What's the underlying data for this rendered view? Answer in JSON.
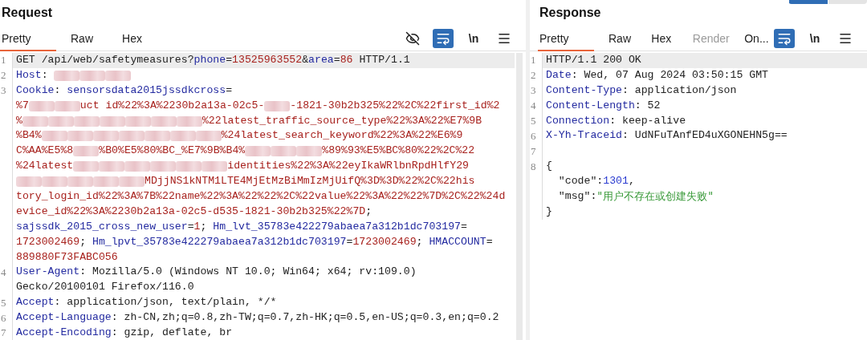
{
  "request": {
    "title": "Request",
    "tabs": [
      {
        "label": "Pretty",
        "selected": true,
        "disabled": false
      },
      {
        "label": "Raw",
        "selected": false,
        "disabled": false
      },
      {
        "label": "Hex",
        "selected": false,
        "disabled": false
      }
    ],
    "toolbar": [
      {
        "kind": "hide"
      },
      {
        "kind": "wrap",
        "on": true
      },
      {
        "kind": "text",
        "label": "\\n"
      },
      {
        "kind": "menu"
      }
    ],
    "lines": [
      {
        "num": "1",
        "highlight": true,
        "segments": [
          {
            "kind": "text",
            "text": "GET /api/web/safetymeasures?"
          },
          {
            "kind": "key",
            "text": "phone"
          },
          {
            "kind": "text",
            "text": "="
          },
          {
            "kind": "val",
            "text": "13525963552"
          },
          {
            "kind": "text",
            "text": "&"
          },
          {
            "kind": "key",
            "text": "area"
          },
          {
            "kind": "text",
            "text": "="
          },
          {
            "kind": "val",
            "text": "86"
          },
          {
            "kind": "text",
            "text": " HTTP/1.1"
          }
        ]
      },
      {
        "num": "2",
        "highlight": false,
        "segments": [
          {
            "kind": "key",
            "text": "Host"
          },
          {
            "kind": "text",
            "text": ": "
          },
          {
            "kind": "redacted"
          },
          {
            "kind": "redacted"
          },
          {
            "kind": "redacted"
          }
        ]
      },
      {
        "num": "3",
        "highlight": false,
        "segments": [
          {
            "kind": "key",
            "text": "Cookie"
          },
          {
            "kind": "text",
            "text": ": "
          },
          {
            "kind": "key",
            "text": "sensorsdata2015jssdkcross"
          },
          {
            "kind": "text",
            "text": "="
          }
        ]
      },
      {
        "highlight": false,
        "segments": [
          {
            "kind": "val",
            "text": "%7"
          },
          {
            "kind": "redacted"
          },
          {
            "kind": "redacted"
          },
          {
            "kind": "val",
            "text": "uct id%22%3A%2230b2a13a-02c5-"
          },
          {
            "kind": "redacted"
          },
          {
            "kind": "val",
            "text": "-1821-30b2b325%22%2C%22first_id%2"
          }
        ]
      },
      {
        "highlight": false,
        "segments": [
          {
            "kind": "val",
            "text": "%"
          },
          {
            "kind": "redacted"
          },
          {
            "kind": "redacted"
          },
          {
            "kind": "redacted"
          },
          {
            "kind": "redacted"
          },
          {
            "kind": "redacted"
          },
          {
            "kind": "redacted"
          },
          {
            "kind": "redacted"
          },
          {
            "kind": "val",
            "text": "%22latest_traffic_source_type%22%3A%22%E7%9B"
          }
        ]
      },
      {
        "highlight": false,
        "segments": [
          {
            "kind": "val",
            "text": "%B4%"
          },
          {
            "kind": "redacted"
          },
          {
            "kind": "redacted"
          },
          {
            "kind": "redacted"
          },
          {
            "kind": "redacted"
          },
          {
            "kind": "redacted"
          },
          {
            "kind": "redacted"
          },
          {
            "kind": "redacted"
          },
          {
            "kind": "val",
            "text": "%24latest_search_keyword%22%3A%22%E6%9"
          }
        ]
      },
      {
        "highlight": false,
        "segments": [
          {
            "kind": "val",
            "text": "C%AA%E5%8"
          },
          {
            "kind": "redacted"
          },
          {
            "kind": "val",
            "text": "%B0%E5%80%BC_%E7%9B%B4%"
          },
          {
            "kind": "redacted"
          },
          {
            "kind": "redacted"
          },
          {
            "kind": "redacted"
          },
          {
            "kind": "val",
            "text": "%89%93%E5%BC%80%22%2C%22"
          }
        ]
      },
      {
        "highlight": false,
        "segments": [
          {
            "kind": "val",
            "text": "%24latest"
          },
          {
            "kind": "redacted"
          },
          {
            "kind": "redacted"
          },
          {
            "kind": "redacted"
          },
          {
            "kind": "redacted"
          },
          {
            "kind": "redacted"
          },
          {
            "kind": "redacted"
          },
          {
            "kind": "val",
            "text": "identities%22%3A%22eyIkaWRlbnRpdHlfY29"
          }
        ]
      },
      {
        "highlight": false,
        "segments": [
          {
            "kind": "redacted"
          },
          {
            "kind": "redacted"
          },
          {
            "kind": "redacted"
          },
          {
            "kind": "redacted"
          },
          {
            "kind": "redacted"
          },
          {
            "kind": "val",
            "text": "MDjjNS1kNTM1LTE4MjEtMzBiMmIzMjUifQ%3D%3D%22%2C%22his"
          }
        ]
      },
      {
        "highlight": false,
        "segments": [
          {
            "kind": "val",
            "text": "tory_login_id%22%3A%7B%22name%22%3A%22%22%2C%22value%22%3A%22%22%7D%2C%22%24d"
          }
        ]
      },
      {
        "highlight": false,
        "segments": [
          {
            "kind": "val",
            "text": "evice_id%22%3A%2230b2a13a-02c5-d535-1821-30b2b325%22%7D"
          },
          {
            "kind": "text",
            "text": ";"
          }
        ]
      },
      {
        "highlight": false,
        "segments": [
          {
            "kind": "key",
            "text": "sajssdk_2015_cross_new_user"
          },
          {
            "kind": "text",
            "text": "="
          },
          {
            "kind": "val",
            "text": "1"
          },
          {
            "kind": "text",
            "text": "; "
          },
          {
            "kind": "key",
            "text": "Hm_lvt_35783e422279abaea7a312b1dc703197"
          },
          {
            "kind": "text",
            "text": "="
          }
        ]
      },
      {
        "highlight": false,
        "segments": [
          {
            "kind": "val",
            "text": "1723002469"
          },
          {
            "kind": "text",
            "text": "; "
          },
          {
            "kind": "key",
            "text": "Hm_lpvt_35783e422279abaea7a312b1dc703197"
          },
          {
            "kind": "text",
            "text": "="
          },
          {
            "kind": "val",
            "text": "1723002469"
          },
          {
            "kind": "text",
            "text": "; "
          },
          {
            "kind": "key",
            "text": "HMACCOUNT"
          },
          {
            "kind": "text",
            "text": "="
          }
        ]
      },
      {
        "highlight": false,
        "segments": [
          {
            "kind": "val",
            "text": "889880F73FABC056"
          }
        ]
      },
      {
        "num": "4",
        "highlight": false,
        "segments": [
          {
            "kind": "key",
            "text": "User-Agent"
          },
          {
            "kind": "text",
            "text": ": Mozilla/5.0 (Windows NT 10.0; Win64; x64; rv:109.0)"
          }
        ]
      },
      {
        "highlight": false,
        "segments": [
          {
            "kind": "text",
            "text": "Gecko/20100101 Firefox/116.0"
          }
        ]
      },
      {
        "num": "5",
        "highlight": false,
        "segments": [
          {
            "kind": "key",
            "text": "Accept"
          },
          {
            "kind": "text",
            "text": ": application/json, text/plain, */*"
          }
        ]
      },
      {
        "num": "6",
        "highlight": false,
        "segments": [
          {
            "kind": "key",
            "text": "Accept-Language"
          },
          {
            "kind": "text",
            "text": ": zh-CN,zh;q=0.8,zh-TW;q=0.7,zh-HK;q=0.5,en-US;q=0.3,en;q=0.2"
          }
        ]
      },
      {
        "num": "7",
        "highlight": false,
        "segments": [
          {
            "kind": "key",
            "text": "Accept-Encoding"
          },
          {
            "kind": "text",
            "text": ": gzip, deflate, br"
          }
        ]
      }
    ]
  },
  "response": {
    "title": "Response",
    "view_toggle": [
      {
        "selected": true
      },
      {
        "selected": false
      }
    ],
    "tabs": [
      {
        "label": "Pretty",
        "selected": true,
        "disabled": false
      },
      {
        "label": "Raw",
        "selected": false,
        "disabled": false
      },
      {
        "label": "Hex",
        "selected": false,
        "disabled": false
      },
      {
        "label": "Render",
        "selected": false,
        "disabled": true
      },
      {
        "label": "On...",
        "selected": false,
        "disabled": false
      }
    ],
    "toolbar": [
      {
        "kind": "wrap",
        "on": true
      },
      {
        "kind": "text",
        "label": "\\n"
      },
      {
        "kind": "menu"
      }
    ],
    "lines": [
      {
        "num": "1",
        "highlight": true,
        "segments": [
          {
            "kind": "text",
            "text": "HTTP/1.1 200 OK"
          }
        ]
      },
      {
        "num": "2",
        "highlight": false,
        "segments": [
          {
            "kind": "key",
            "text": "Date"
          },
          {
            "kind": "text",
            "text": ": Wed, 07 Aug 2024 03:50:15 GMT"
          }
        ]
      },
      {
        "num": "3",
        "highlight": false,
        "segments": [
          {
            "kind": "key",
            "text": "Content-Type"
          },
          {
            "kind": "text",
            "text": ": application/json"
          }
        ]
      },
      {
        "num": "4",
        "highlight": false,
        "segments": [
          {
            "kind": "key",
            "text": "Content-Length"
          },
          {
            "kind": "text",
            "text": ": 52"
          }
        ]
      },
      {
        "num": "5",
        "highlight": false,
        "segments": [
          {
            "kind": "key",
            "text": "Connection"
          },
          {
            "kind": "text",
            "text": ": keep-alive"
          }
        ]
      },
      {
        "num": "6",
        "highlight": false,
        "segments": [
          {
            "kind": "key",
            "text": "X-Yh-Traceid"
          },
          {
            "kind": "text",
            "text": ": UdNFuTAnfED4uXGONEHN5g=="
          }
        ]
      },
      {
        "num": "7",
        "highlight": false
      },
      {
        "num": "8",
        "highlight": false,
        "segments": [
          {
            "kind": "text",
            "text": "{"
          }
        ]
      },
      {
        "highlight": false,
        "segments": [
          {
            "kind": "text",
            "text": "  \"code\":"
          },
          {
            "kind": "num",
            "text": "1301"
          },
          {
            "kind": "text",
            "text": ","
          }
        ]
      },
      {
        "highlight": false,
        "segments": [
          {
            "kind": "text",
            "text": "  \"msg\":"
          },
          {
            "kind": "str",
            "text": "\"用户不存在或创建失败\""
          }
        ]
      },
      {
        "highlight": false,
        "segments": [
          {
            "kind": "text",
            "text": "}"
          }
        ]
      }
    ]
  }
}
